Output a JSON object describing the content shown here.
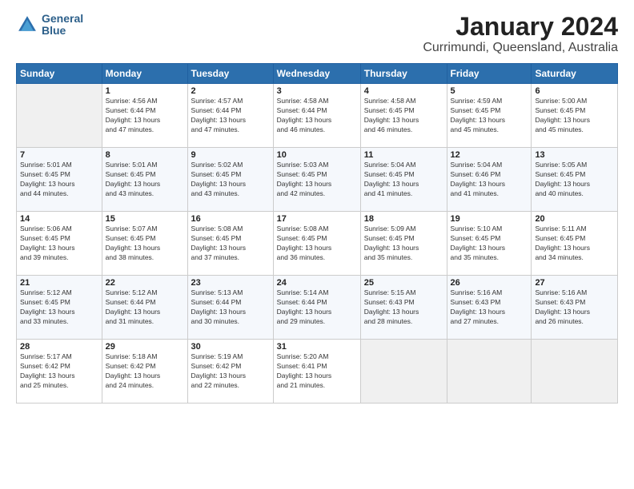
{
  "header": {
    "logo_line1": "General",
    "logo_line2": "Blue",
    "title": "January 2024",
    "subtitle": "Currimundi, Queensland, Australia"
  },
  "weekdays": [
    "Sunday",
    "Monday",
    "Tuesday",
    "Wednesday",
    "Thursday",
    "Friday",
    "Saturday"
  ],
  "weeks": [
    [
      {
        "day": "",
        "sunrise": "",
        "sunset": "",
        "daylight": ""
      },
      {
        "day": "1",
        "sunrise": "Sunrise: 4:56 AM",
        "sunset": "Sunset: 6:44 PM",
        "daylight": "Daylight: 13 hours and 47 minutes."
      },
      {
        "day": "2",
        "sunrise": "Sunrise: 4:57 AM",
        "sunset": "Sunset: 6:44 PM",
        "daylight": "Daylight: 13 hours and 47 minutes."
      },
      {
        "day": "3",
        "sunrise": "Sunrise: 4:58 AM",
        "sunset": "Sunset: 6:44 PM",
        "daylight": "Daylight: 13 hours and 46 minutes."
      },
      {
        "day": "4",
        "sunrise": "Sunrise: 4:58 AM",
        "sunset": "Sunset: 6:45 PM",
        "daylight": "Daylight: 13 hours and 46 minutes."
      },
      {
        "day": "5",
        "sunrise": "Sunrise: 4:59 AM",
        "sunset": "Sunset: 6:45 PM",
        "daylight": "Daylight: 13 hours and 45 minutes."
      },
      {
        "day": "6",
        "sunrise": "Sunrise: 5:00 AM",
        "sunset": "Sunset: 6:45 PM",
        "daylight": "Daylight: 13 hours and 45 minutes."
      }
    ],
    [
      {
        "day": "7",
        "sunrise": "Sunrise: 5:01 AM",
        "sunset": "Sunset: 6:45 PM",
        "daylight": "Daylight: 13 hours and 44 minutes."
      },
      {
        "day": "8",
        "sunrise": "Sunrise: 5:01 AM",
        "sunset": "Sunset: 6:45 PM",
        "daylight": "Daylight: 13 hours and 43 minutes."
      },
      {
        "day": "9",
        "sunrise": "Sunrise: 5:02 AM",
        "sunset": "Sunset: 6:45 PM",
        "daylight": "Daylight: 13 hours and 43 minutes."
      },
      {
        "day": "10",
        "sunrise": "Sunrise: 5:03 AM",
        "sunset": "Sunset: 6:45 PM",
        "daylight": "Daylight: 13 hours and 42 minutes."
      },
      {
        "day": "11",
        "sunrise": "Sunrise: 5:04 AM",
        "sunset": "Sunset: 6:45 PM",
        "daylight": "Daylight: 13 hours and 41 minutes."
      },
      {
        "day": "12",
        "sunrise": "Sunrise: 5:04 AM",
        "sunset": "Sunset: 6:46 PM",
        "daylight": "Daylight: 13 hours and 41 minutes."
      },
      {
        "day": "13",
        "sunrise": "Sunrise: 5:05 AM",
        "sunset": "Sunset: 6:45 PM",
        "daylight": "Daylight: 13 hours and 40 minutes."
      }
    ],
    [
      {
        "day": "14",
        "sunrise": "Sunrise: 5:06 AM",
        "sunset": "Sunset: 6:45 PM",
        "daylight": "Daylight: 13 hours and 39 minutes."
      },
      {
        "day": "15",
        "sunrise": "Sunrise: 5:07 AM",
        "sunset": "Sunset: 6:45 PM",
        "daylight": "Daylight: 13 hours and 38 minutes."
      },
      {
        "day": "16",
        "sunrise": "Sunrise: 5:08 AM",
        "sunset": "Sunset: 6:45 PM",
        "daylight": "Daylight: 13 hours and 37 minutes."
      },
      {
        "day": "17",
        "sunrise": "Sunrise: 5:08 AM",
        "sunset": "Sunset: 6:45 PM",
        "daylight": "Daylight: 13 hours and 36 minutes."
      },
      {
        "day": "18",
        "sunrise": "Sunrise: 5:09 AM",
        "sunset": "Sunset: 6:45 PM",
        "daylight": "Daylight: 13 hours and 35 minutes."
      },
      {
        "day": "19",
        "sunrise": "Sunrise: 5:10 AM",
        "sunset": "Sunset: 6:45 PM",
        "daylight": "Daylight: 13 hours and 35 minutes."
      },
      {
        "day": "20",
        "sunrise": "Sunrise: 5:11 AM",
        "sunset": "Sunset: 6:45 PM",
        "daylight": "Daylight: 13 hours and 34 minutes."
      }
    ],
    [
      {
        "day": "21",
        "sunrise": "Sunrise: 5:12 AM",
        "sunset": "Sunset: 6:45 PM",
        "daylight": "Daylight: 13 hours and 33 minutes."
      },
      {
        "day": "22",
        "sunrise": "Sunrise: 5:12 AM",
        "sunset": "Sunset: 6:44 PM",
        "daylight": "Daylight: 13 hours and 31 minutes."
      },
      {
        "day": "23",
        "sunrise": "Sunrise: 5:13 AM",
        "sunset": "Sunset: 6:44 PM",
        "daylight": "Daylight: 13 hours and 30 minutes."
      },
      {
        "day": "24",
        "sunrise": "Sunrise: 5:14 AM",
        "sunset": "Sunset: 6:44 PM",
        "daylight": "Daylight: 13 hours and 29 minutes."
      },
      {
        "day": "25",
        "sunrise": "Sunrise: 5:15 AM",
        "sunset": "Sunset: 6:43 PM",
        "daylight": "Daylight: 13 hours and 28 minutes."
      },
      {
        "day": "26",
        "sunrise": "Sunrise: 5:16 AM",
        "sunset": "Sunset: 6:43 PM",
        "daylight": "Daylight: 13 hours and 27 minutes."
      },
      {
        "day": "27",
        "sunrise": "Sunrise: 5:16 AM",
        "sunset": "Sunset: 6:43 PM",
        "daylight": "Daylight: 13 hours and 26 minutes."
      }
    ],
    [
      {
        "day": "28",
        "sunrise": "Sunrise: 5:17 AM",
        "sunset": "Sunset: 6:42 PM",
        "daylight": "Daylight: 13 hours and 25 minutes."
      },
      {
        "day": "29",
        "sunrise": "Sunrise: 5:18 AM",
        "sunset": "Sunset: 6:42 PM",
        "daylight": "Daylight: 13 hours and 24 minutes."
      },
      {
        "day": "30",
        "sunrise": "Sunrise: 5:19 AM",
        "sunset": "Sunset: 6:42 PM",
        "daylight": "Daylight: 13 hours and 22 minutes."
      },
      {
        "day": "31",
        "sunrise": "Sunrise: 5:20 AM",
        "sunset": "Sunset: 6:41 PM",
        "daylight": "Daylight: 13 hours and 21 minutes."
      },
      {
        "day": "",
        "sunrise": "",
        "sunset": "",
        "daylight": ""
      },
      {
        "day": "",
        "sunrise": "",
        "sunset": "",
        "daylight": ""
      },
      {
        "day": "",
        "sunrise": "",
        "sunset": "",
        "daylight": ""
      }
    ]
  ]
}
